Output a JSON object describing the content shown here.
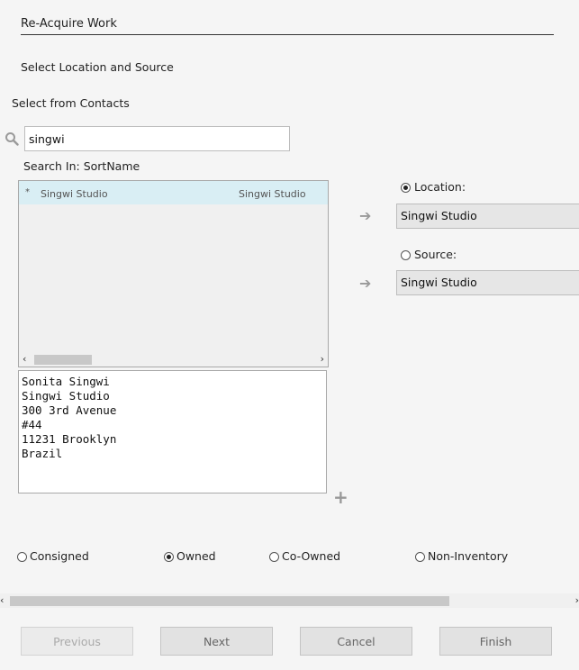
{
  "header": {
    "title": "Re-Acquire Work"
  },
  "section_title": "Select Location and Source",
  "contacts": {
    "heading": "Select from Contacts",
    "search_value": "singwi",
    "search_in": "Search In: SortName",
    "results": [
      {
        "mark": "*",
        "name": "Singwi Studio",
        "sortname": "Singwi Studio"
      }
    ],
    "address_lines": [
      "Sonita Singwi",
      "Singwi Studio",
      "300 3rd Avenue",
      "#44",
      "11231 Brooklyn",
      "Brazil"
    ]
  },
  "location": {
    "label": "Location:",
    "value": "Singwi Studio",
    "selected": true
  },
  "source": {
    "label": "Source:",
    "value": "Singwi Studio",
    "selected": false
  },
  "status_options": [
    {
      "label": "Consigned",
      "selected": false
    },
    {
      "label": "Owned",
      "selected": true
    },
    {
      "label": "Co-Owned",
      "selected": false
    },
    {
      "label": "Non-Inventory",
      "selected": false
    }
  ],
  "buttons": {
    "previous": "Previous",
    "next": "Next",
    "cancel": "Cancel",
    "finish": "Finish"
  },
  "icons": {
    "search": "search-icon",
    "arrow": "arrow-right-icon",
    "add": "plus-icon",
    "scroll_left": "chevron-left-icon",
    "scroll_right": "chevron-right-icon"
  }
}
